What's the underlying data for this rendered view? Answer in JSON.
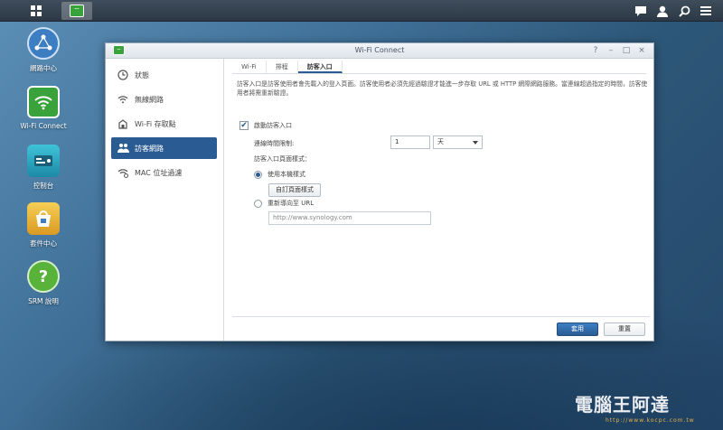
{
  "taskbar": {
    "main_menu_icon": "grid-icon",
    "active_app_icon": "wifi-icon",
    "right_icons": [
      "chat-icon",
      "user-icon",
      "search-icon",
      "options-icon"
    ]
  },
  "desktop": {
    "icons": [
      {
        "label": "網路中心",
        "icon": "network-center-icon",
        "color": "#3d7ec2"
      },
      {
        "label": "Wi-Fi Connect",
        "icon": "wifi-icon",
        "color": "#39a23a"
      },
      {
        "label": "控制台",
        "icon": "control-panel-icon",
        "color": "#24a7c4"
      },
      {
        "label": "套件中心",
        "icon": "package-center-icon",
        "color": "#e7b43a"
      },
      {
        "label": "SRM 說明",
        "icon": "help-icon",
        "color": "#59b23a"
      }
    ]
  },
  "window": {
    "title": "Wi-Fi Connect",
    "controls": [
      "?",
      "–",
      "□",
      "×"
    ],
    "sidebar": {
      "items": [
        {
          "label": "狀態",
          "icon": "status-clock-icon"
        },
        {
          "label": "無線網路",
          "icon": "wifi-icon"
        },
        {
          "label": "Wi-Fi 存取點",
          "icon": "access-point-icon"
        },
        {
          "label": "訪客網路",
          "icon": "guest-network-icon",
          "active": true
        },
        {
          "label": "MAC 位址過濾",
          "icon": "mac-filter-icon"
        }
      ]
    },
    "tabs": [
      {
        "label": "Wi-Fi"
      },
      {
        "label": "排程"
      },
      {
        "label": "訪客入口",
        "active": true
      }
    ],
    "description": "訪客入口是訪客使用者會先載入的登入頁面。訪客使用者必須先經過驗證才能進一步存取 URL 或 HTTP 網際網路服務。當連線超過指定的時間，訪客使用者將需重新驗證。",
    "enable_label": "啟動訪客入口",
    "enable_checked": true,
    "timeout_label": "連線時間限制:",
    "timeout_value": "1",
    "timeout_unit": "天",
    "style_label": "訪客入口頁面樣式：",
    "option_local_label": "使用本機樣式",
    "option_local_selected": true,
    "customize_button": "自訂頁面樣式",
    "option_redirect_label": "重新導向至 URL",
    "url_placeholder": "http://www.synology.com",
    "apply_button": "套用",
    "reset_button": "重置"
  },
  "watermark": {
    "text": "電腦王阿達",
    "url": "http://www.kocpc.com.tw"
  }
}
